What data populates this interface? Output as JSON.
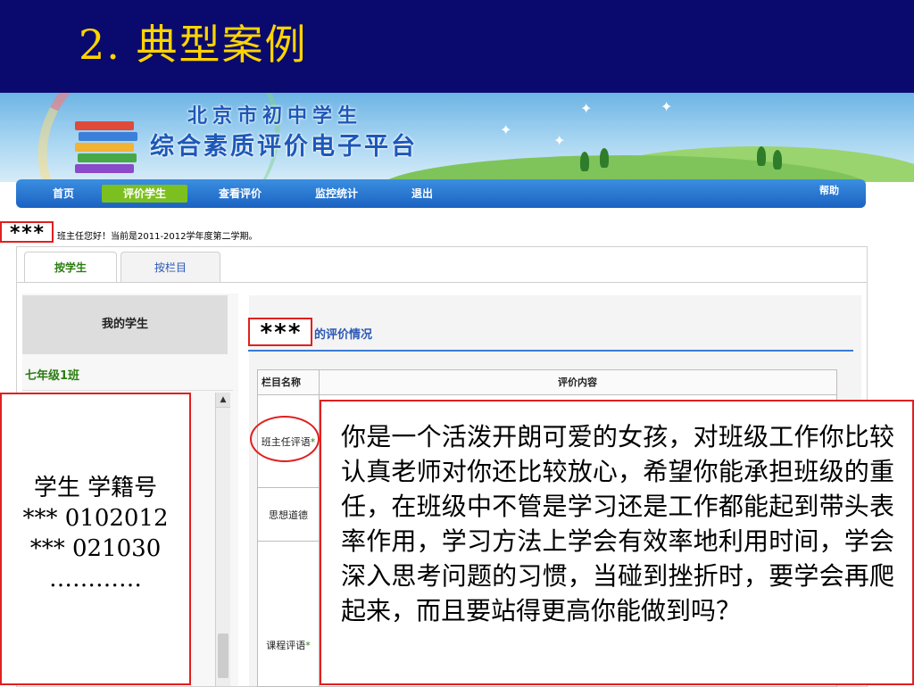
{
  "slide": {
    "title": "2. 典型案例"
  },
  "banner": {
    "line1": "北京市初中学生",
    "line2": "综合素质评价电子平台"
  },
  "nav": {
    "items": [
      "首页",
      "评价学生",
      "查看评价",
      "监控统计",
      "退出"
    ],
    "active": "评价学生",
    "help": "帮助"
  },
  "greeting": {
    "masked": "***",
    "text": "班主任您好！当前是2011-2012学年度第二学期。"
  },
  "tabs": [
    "按学生",
    "按栏目"
  ],
  "sidebar": {
    "header": "我的学生",
    "class_name": "七年级1班",
    "scroll_up": "▲"
  },
  "main": {
    "masked_name": "***",
    "heading": "的评价情况",
    "table": {
      "col1": "栏目名称",
      "col2": "评价内容",
      "rows": [
        {
          "label": "班主任评语",
          "required": "*"
        },
        {
          "label": "思想道德",
          "required": ""
        },
        {
          "label": "课程评语",
          "required": "*"
        }
      ]
    }
  },
  "overlay_students": {
    "header": "学生  学籍号",
    "rows": [
      "*** 0102012",
      "*** 021030"
    ],
    "ellipsis": "…………"
  },
  "overlay_comment": {
    "text": "你是一个活泼开朗可爱的女孩，对班级工作你比较认真老师对你还比较放心，希望你能承担班级的重任，在班级中不管是学习还是工作都能起到带头表率作用，学习方法上学会有效率地利用时间，学会深入思考问题的习惯，当碰到挫折时，要学会再爬起来，而且要站得更高你能做到吗？"
  },
  "colors": {
    "header_bg": "#0a0a6e",
    "title": "#ffd400",
    "nav": "#1a62c2",
    "nav_active": "#7cc01f",
    "highlight": "#e02020"
  }
}
